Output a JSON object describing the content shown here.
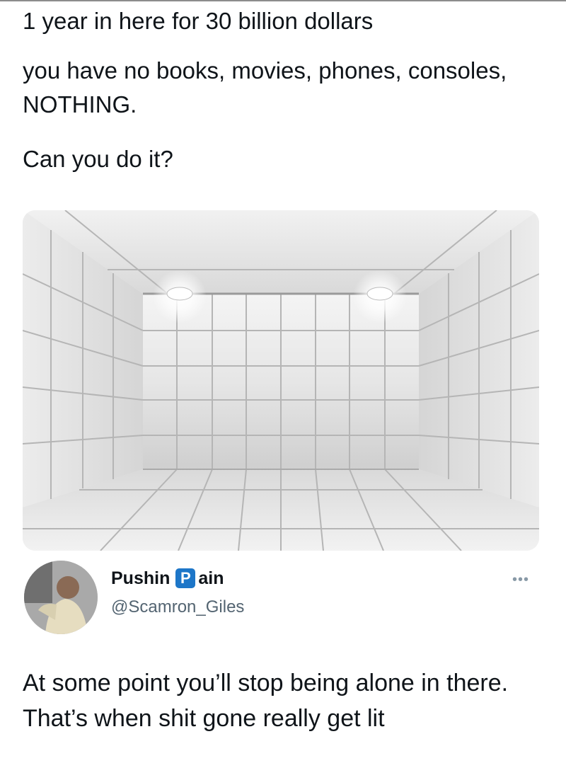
{
  "tweet": {
    "line1": "1 year in here for 30 billion dollars",
    "line2": "you have no books, movies, phones, consoles, NOTHING.",
    "line3": "Can you do it?"
  },
  "reply": {
    "display_name_prefix": "Pushin",
    "display_name_badge": "P",
    "display_name_suffix": "ain",
    "handle": "@Scamron_Giles",
    "more_icon": "more-horizontal-icon",
    "text": "At some point you’ll stop being alone in there. That’s when shit gone really get lit"
  }
}
